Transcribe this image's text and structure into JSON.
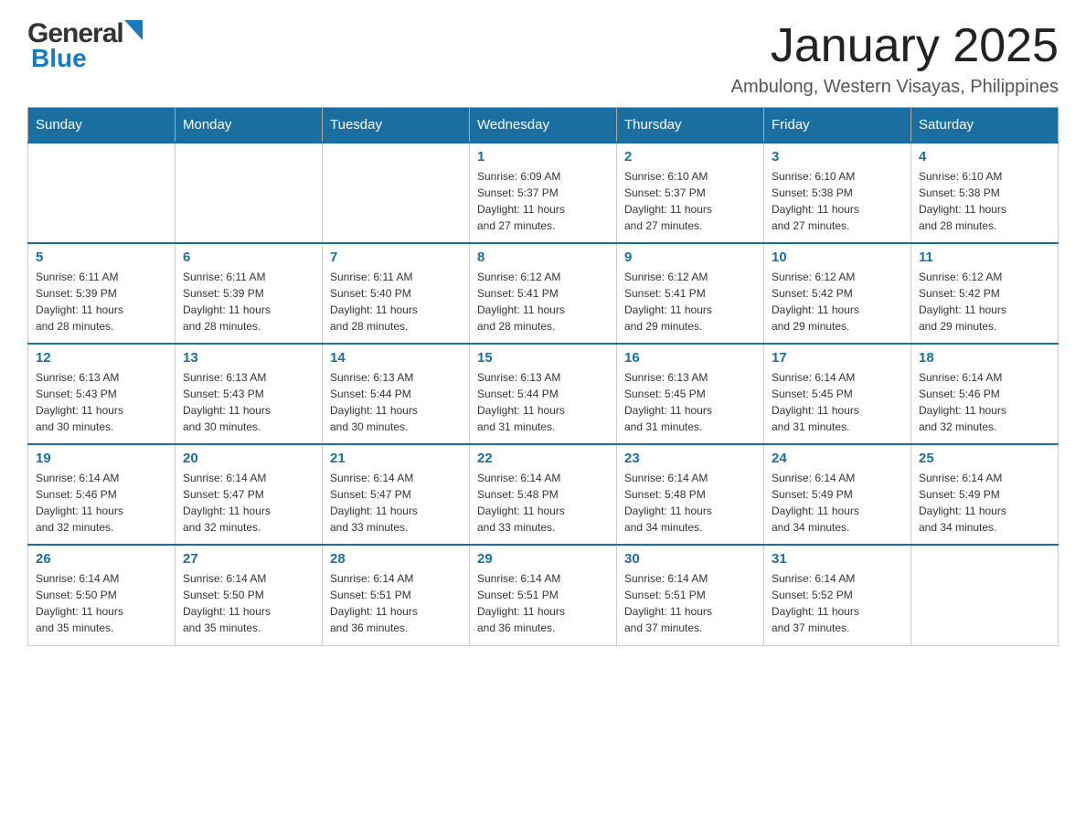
{
  "header": {
    "logo_general": "General",
    "logo_blue": "Blue",
    "month_title": "January 2025",
    "location": "Ambulong, Western Visayas, Philippines"
  },
  "calendar": {
    "days_of_week": [
      "Sunday",
      "Monday",
      "Tuesday",
      "Wednesday",
      "Thursday",
      "Friday",
      "Saturday"
    ],
    "weeks": [
      {
        "days": [
          {
            "number": "",
            "info": ""
          },
          {
            "number": "",
            "info": ""
          },
          {
            "number": "",
            "info": ""
          },
          {
            "number": "1",
            "info": "Sunrise: 6:09 AM\nSunset: 5:37 PM\nDaylight: 11 hours\nand 27 minutes."
          },
          {
            "number": "2",
            "info": "Sunrise: 6:10 AM\nSunset: 5:37 PM\nDaylight: 11 hours\nand 27 minutes."
          },
          {
            "number": "3",
            "info": "Sunrise: 6:10 AM\nSunset: 5:38 PM\nDaylight: 11 hours\nand 27 minutes."
          },
          {
            "number": "4",
            "info": "Sunrise: 6:10 AM\nSunset: 5:38 PM\nDaylight: 11 hours\nand 28 minutes."
          }
        ]
      },
      {
        "days": [
          {
            "number": "5",
            "info": "Sunrise: 6:11 AM\nSunset: 5:39 PM\nDaylight: 11 hours\nand 28 minutes."
          },
          {
            "number": "6",
            "info": "Sunrise: 6:11 AM\nSunset: 5:39 PM\nDaylight: 11 hours\nand 28 minutes."
          },
          {
            "number": "7",
            "info": "Sunrise: 6:11 AM\nSunset: 5:40 PM\nDaylight: 11 hours\nand 28 minutes."
          },
          {
            "number": "8",
            "info": "Sunrise: 6:12 AM\nSunset: 5:41 PM\nDaylight: 11 hours\nand 28 minutes."
          },
          {
            "number": "9",
            "info": "Sunrise: 6:12 AM\nSunset: 5:41 PM\nDaylight: 11 hours\nand 29 minutes."
          },
          {
            "number": "10",
            "info": "Sunrise: 6:12 AM\nSunset: 5:42 PM\nDaylight: 11 hours\nand 29 minutes."
          },
          {
            "number": "11",
            "info": "Sunrise: 6:12 AM\nSunset: 5:42 PM\nDaylight: 11 hours\nand 29 minutes."
          }
        ]
      },
      {
        "days": [
          {
            "number": "12",
            "info": "Sunrise: 6:13 AM\nSunset: 5:43 PM\nDaylight: 11 hours\nand 30 minutes."
          },
          {
            "number": "13",
            "info": "Sunrise: 6:13 AM\nSunset: 5:43 PM\nDaylight: 11 hours\nand 30 minutes."
          },
          {
            "number": "14",
            "info": "Sunrise: 6:13 AM\nSunset: 5:44 PM\nDaylight: 11 hours\nand 30 minutes."
          },
          {
            "number": "15",
            "info": "Sunrise: 6:13 AM\nSunset: 5:44 PM\nDaylight: 11 hours\nand 31 minutes."
          },
          {
            "number": "16",
            "info": "Sunrise: 6:13 AM\nSunset: 5:45 PM\nDaylight: 11 hours\nand 31 minutes."
          },
          {
            "number": "17",
            "info": "Sunrise: 6:14 AM\nSunset: 5:45 PM\nDaylight: 11 hours\nand 31 minutes."
          },
          {
            "number": "18",
            "info": "Sunrise: 6:14 AM\nSunset: 5:46 PM\nDaylight: 11 hours\nand 32 minutes."
          }
        ]
      },
      {
        "days": [
          {
            "number": "19",
            "info": "Sunrise: 6:14 AM\nSunset: 5:46 PM\nDaylight: 11 hours\nand 32 minutes."
          },
          {
            "number": "20",
            "info": "Sunrise: 6:14 AM\nSunset: 5:47 PM\nDaylight: 11 hours\nand 32 minutes."
          },
          {
            "number": "21",
            "info": "Sunrise: 6:14 AM\nSunset: 5:47 PM\nDaylight: 11 hours\nand 33 minutes."
          },
          {
            "number": "22",
            "info": "Sunrise: 6:14 AM\nSunset: 5:48 PM\nDaylight: 11 hours\nand 33 minutes."
          },
          {
            "number": "23",
            "info": "Sunrise: 6:14 AM\nSunset: 5:48 PM\nDaylight: 11 hours\nand 34 minutes."
          },
          {
            "number": "24",
            "info": "Sunrise: 6:14 AM\nSunset: 5:49 PM\nDaylight: 11 hours\nand 34 minutes."
          },
          {
            "number": "25",
            "info": "Sunrise: 6:14 AM\nSunset: 5:49 PM\nDaylight: 11 hours\nand 34 minutes."
          }
        ]
      },
      {
        "days": [
          {
            "number": "26",
            "info": "Sunrise: 6:14 AM\nSunset: 5:50 PM\nDaylight: 11 hours\nand 35 minutes."
          },
          {
            "number": "27",
            "info": "Sunrise: 6:14 AM\nSunset: 5:50 PM\nDaylight: 11 hours\nand 35 minutes."
          },
          {
            "number": "28",
            "info": "Sunrise: 6:14 AM\nSunset: 5:51 PM\nDaylight: 11 hours\nand 36 minutes."
          },
          {
            "number": "29",
            "info": "Sunrise: 6:14 AM\nSunset: 5:51 PM\nDaylight: 11 hours\nand 36 minutes."
          },
          {
            "number": "30",
            "info": "Sunrise: 6:14 AM\nSunset: 5:51 PM\nDaylight: 11 hours\nand 37 minutes."
          },
          {
            "number": "31",
            "info": "Sunrise: 6:14 AM\nSunset: 5:52 PM\nDaylight: 11 hours\nand 37 minutes."
          },
          {
            "number": "",
            "info": ""
          }
        ]
      }
    ]
  }
}
